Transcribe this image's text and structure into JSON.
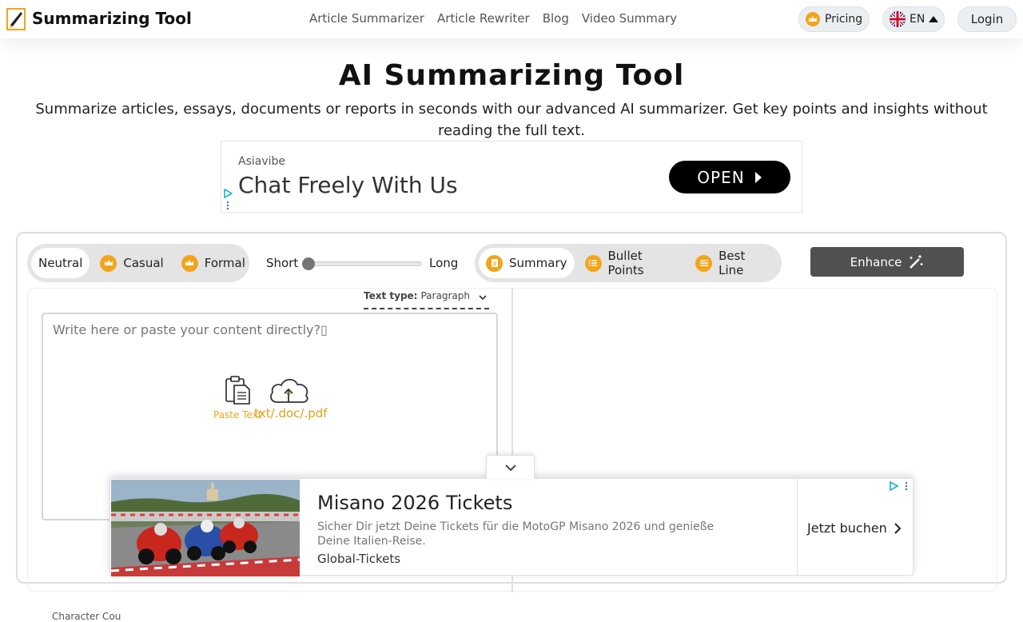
{
  "header": {
    "brand": "Summarizing Tool",
    "nav": [
      "Article Summarizer",
      "Article Rewriter",
      "Blog",
      "Video Summary"
    ],
    "pricing_label": "Pricing",
    "lang_label": "EN",
    "login_label": "Login"
  },
  "hero": {
    "title": "AI Summarizing Tool",
    "subtitle": "Summarize articles, essays, documents or reports in seconds with our advanced AI summarizer. Get key points and insights without reading the full text."
  },
  "ad_top": {
    "advertiser": "Asiavibe",
    "headline": "Chat Freely With Us",
    "cta": "OPEN"
  },
  "tool": {
    "modes": [
      "Neutral",
      "Casual",
      "Formal"
    ],
    "active_mode": "Neutral",
    "length_short": "Short",
    "length_long": "Long",
    "length_value": 0,
    "outputs": [
      "Summary",
      "Bullet Points",
      "Best Line"
    ],
    "active_output": "Summary",
    "enhance_label": "Enhance",
    "text_type_label": "Text type:",
    "text_type_value": "Paragraph",
    "input_placeholder": "Write here or paste your content directly?▯",
    "paste_label": "Paste Text",
    "upload_label": "txt/.doc/.pdf",
    "char_count_label": "Character Cou"
  },
  "ad_bottom": {
    "title": "Misano 2026 Tickets",
    "description": "Sicher Dir jetzt Deine Tickets für die MotoGP Misano 2026 und genieße Deine Italien-Reise.",
    "source": "Global-Tickets",
    "cta": "Jetzt buchen"
  },
  "colors": {
    "accent": "#f3a41a",
    "enhance_bg": "#505050",
    "adchoices": "#00aecd"
  }
}
